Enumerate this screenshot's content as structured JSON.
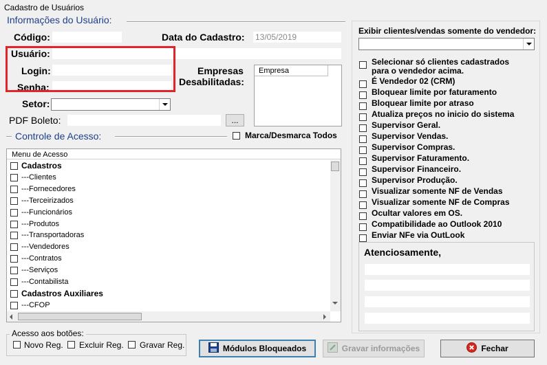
{
  "window": {
    "title": "Cadastro de Usuários"
  },
  "user_info": {
    "section_title": "Informações do Usuário:",
    "codigo_label": "Código:",
    "codigo_value": "",
    "data_cadastro_label": "Data do Cadastro:",
    "data_cadastro_value": "13/05/2019",
    "usuario_label": "Usuário:",
    "login_label": "Login:",
    "senha_label": "Senha:",
    "empresas_label_1": "Empresas",
    "empresas_label_2": "Desabilitadas:",
    "empresa_column": "Empresa",
    "setor_label": "Setor:",
    "pdf_boleto_label": "PDF Boleto:",
    "browse_label": "..."
  },
  "access_control": {
    "section_title": "Controle de Acesso:",
    "toggle_all_label": "Marca/Desmarca Todos",
    "menu_header": "Menu de Acesso",
    "menu_items": [
      {
        "label": "Cadastros",
        "bold": true
      },
      {
        "label": "---Clientes",
        "bold": false
      },
      {
        "label": "---Fornecedores",
        "bold": false
      },
      {
        "label": "---Terceirizados",
        "bold": false
      },
      {
        "label": "---Funcionários",
        "bold": false
      },
      {
        "label": "---Produtos",
        "bold": false
      },
      {
        "label": "---Transportadoras",
        "bold": false
      },
      {
        "label": "---Vendedores",
        "bold": false
      },
      {
        "label": "---Contratos",
        "bold": false
      },
      {
        "label": "---Serviços",
        "bold": false
      },
      {
        "label": "---Contabilista",
        "bold": false
      },
      {
        "label": "Cadastros Auxiliares",
        "bold": true
      },
      {
        "label": "---CFOP",
        "bold": false
      }
    ]
  },
  "button_access": {
    "title": "Acesso aos botões:",
    "novo": "Novo Reg.",
    "excluir": "Excluir Reg.",
    "gravar": "Gravar Reg."
  },
  "right_panel": {
    "vendor_filter_label": "Exibir clientes/vendas somente do vendedor:",
    "options": [
      "Selecionar só clientes cadastrados",
      "É Vendedor 02 (CRM)",
      "Bloquear limite por faturamento",
      "Bloquear limite por atraso",
      "Atualiza preços no inicio do sistema",
      "Supervisor Geral.",
      "Supervisor Vendas.",
      "Supervisor Compras.",
      "Supervisor Faturamento.",
      "Supervisor Financeiro.",
      "Supervisor Produção.",
      "Visualizar somente NF de Vendas",
      "Visualizar somente NF de Compras",
      "Ocultar valores em OS.",
      "Compatibilidade ao Outlook 2010",
      "Enviar NFe via OutLook"
    ],
    "option0_line2": "para o vendedor acima.",
    "signature_label": "Atenciosamente,"
  },
  "buttons": {
    "modulos": "Módulos Bloqueados",
    "gravar": "Gravar informações",
    "fechar": "Fechar"
  }
}
